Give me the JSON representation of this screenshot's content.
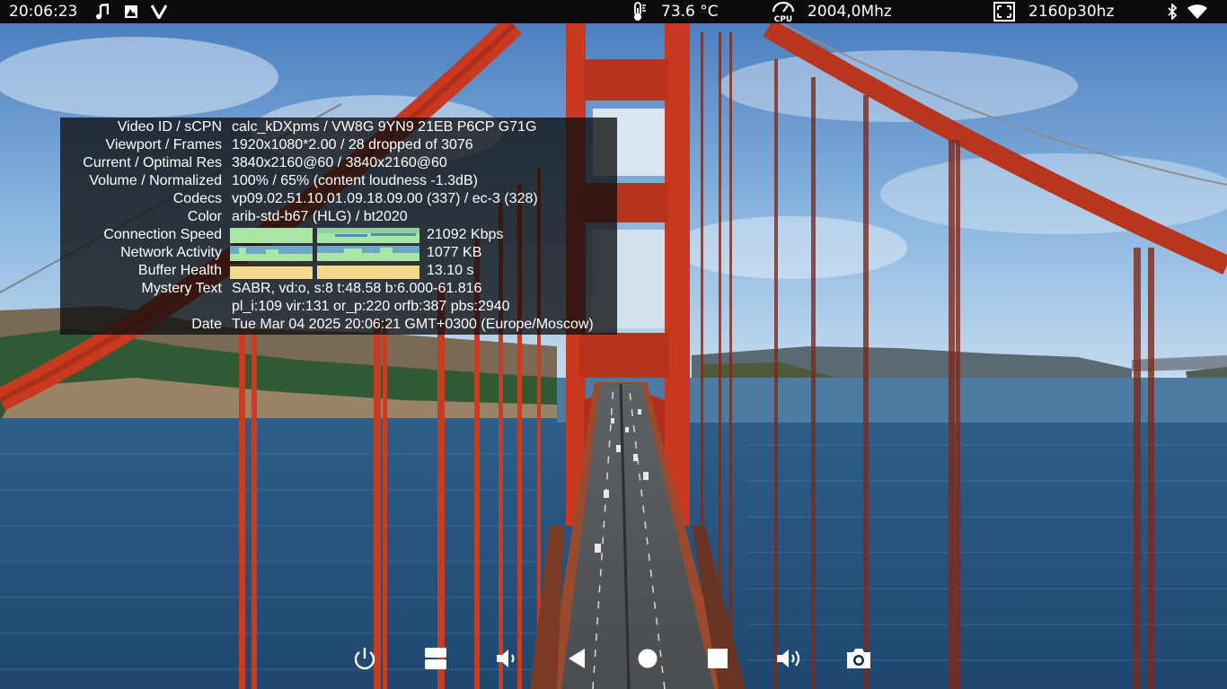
{
  "status_bar": {
    "time": "20:06:23",
    "cpu_temp": "73.6 °C",
    "cpu_freq": "2004,0Mhz",
    "resolution": "2160p30hz",
    "icons": [
      "music-note-icon",
      "image-icon",
      "v-app-icon",
      "thermometer-icon",
      "cpu-icon",
      "fullscreen-icon",
      "bluetooth-icon",
      "wifi-icon"
    ]
  },
  "stats_panel": {
    "rows": [
      {
        "label": "Video ID / sCPN",
        "value": "calc_kDXpms / VW8G 9YN9 21EB P6CP G71G"
      },
      {
        "label": "Viewport / Frames",
        "value": "1920x1080*2.00 / 28 dropped of 3076"
      },
      {
        "label": "Current / Optimal Res",
        "value": "3840x2160@60 / 3840x2160@60"
      },
      {
        "label": "Volume / Normalized",
        "value": "100% / 65% (content loudness -1.3dB)"
      },
      {
        "label": "Codecs",
        "value": "vp09.02.51.10.01.09.18.09.00 (337) / ec-3 (328)"
      },
      {
        "label": "Color",
        "value": "arib-std-b67 (HLG) / bt2020"
      }
    ],
    "connection_speed": {
      "label": "Connection Speed",
      "value": "21092 Kbps"
    },
    "network_activity": {
      "label": "Network Activity",
      "value": "1077 KB"
    },
    "buffer_health": {
      "label": "Buffer Health",
      "value": "13.10 s"
    },
    "mystery_text": {
      "label": "Mystery Text",
      "line1": "SABR, vd:o, s:8 t:48.58 b:6.000-61.816",
      "line2": "pl_i:109 vir:131 or_p:220 orfb:387 pbs:2940"
    },
    "date": {
      "label": "Date",
      "value": "Tue Mar 04 2025 20:06:21 GMT+0300 (Europe/Moscow)"
    }
  },
  "nav_bar": {
    "buttons": [
      "power-icon",
      "window-toggle-icon",
      "volume-down-icon",
      "back-icon",
      "home-icon",
      "recents-icon",
      "volume-up-icon",
      "screenshot-icon"
    ]
  },
  "colors": {
    "status_bar_bg": "#0b0b0d",
    "panel_bg": "rgba(14,14,14,0.78)",
    "speed_graph": "#a9e6a5",
    "network_graph": "#a9e6a5",
    "buffer_graph": "#f3d98c",
    "bridge_red": "#c8391f"
  }
}
